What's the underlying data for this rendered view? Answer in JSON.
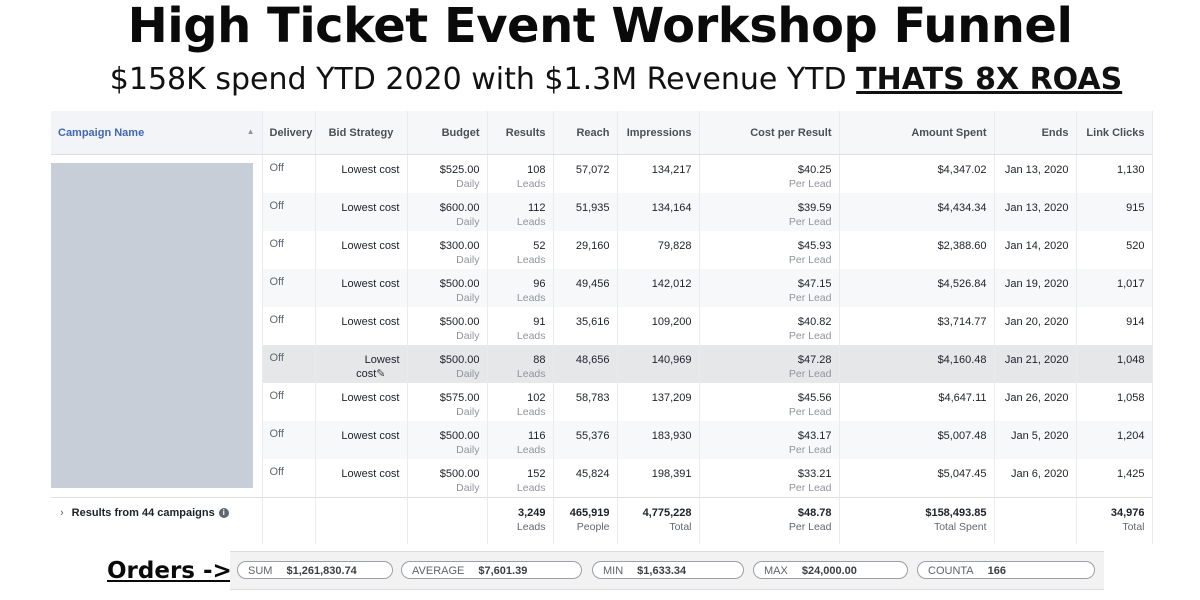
{
  "headline": "High Ticket Event Workshop Funnel",
  "subline": {
    "text": "$158K spend YTD 2020 with $1.3M Revenue YTD",
    "emphasis": "THATS 8X ROAS"
  },
  "table": {
    "headers": {
      "campaign_name": "Campaign Name",
      "delivery": "Delivery",
      "bid_strategy": "Bid Strategy",
      "budget": "Budget",
      "results": "Results",
      "reach": "Reach",
      "impressions": "Impressions",
      "cost_per_result": "Cost per Result",
      "amount_spent": "Amount Spent",
      "ends": "Ends",
      "link_clicks": "Link Clicks"
    },
    "sort_icon": "sort-up-icon",
    "rows": [
      {
        "delivery": "Off",
        "bid": "Lowest cost",
        "budget": "$525.00",
        "budget_sub": "Daily",
        "results": "108",
        "results_sub": "Leads",
        "reach": "57,072",
        "impressions": "134,217",
        "cpr": "$40.25",
        "cpr_sub": "Per Lead",
        "spent": "$4,347.02",
        "ends": "Jan 13, 2020",
        "clicks": "1,130"
      },
      {
        "delivery": "Off",
        "bid": "Lowest cost",
        "budget": "$600.00",
        "budget_sub": "Daily",
        "results": "112",
        "results_sub": "Leads",
        "reach": "51,935",
        "impressions": "134,164",
        "cpr": "$39.59",
        "cpr_sub": "Per Lead",
        "spent": "$4,434.34",
        "ends": "Jan 13, 2020",
        "clicks": "915"
      },
      {
        "delivery": "Off",
        "bid": "Lowest cost",
        "budget": "$300.00",
        "budget_sub": "Daily",
        "results": "52",
        "results_sub": "Leads",
        "reach": "29,160",
        "impressions": "79,828",
        "cpr": "$45.93",
        "cpr_sub": "Per Lead",
        "spent": "$2,388.60",
        "ends": "Jan 14, 2020",
        "clicks": "520"
      },
      {
        "delivery": "Off",
        "bid": "Lowest cost",
        "budget": "$500.00",
        "budget_sub": "Daily",
        "results": "96",
        "results_sub": "Leads",
        "reach": "49,456",
        "impressions": "142,012",
        "cpr": "$47.15",
        "cpr_sub": "Per Lead",
        "spent": "$4,526.84",
        "ends": "Jan 19, 2020",
        "clicks": "1,017"
      },
      {
        "delivery": "Off",
        "bid": "Lowest cost",
        "budget": "$500.00",
        "budget_sub": "Daily",
        "results": "91",
        "results_sub": "Leads",
        "reach": "35,616",
        "impressions": "109,200",
        "cpr": "$40.82",
        "cpr_sub": "Per Lead",
        "spent": "$3,714.77",
        "ends": "Jan 20, 2020",
        "clicks": "914"
      },
      {
        "delivery": "Off",
        "bid": "Lowest cost",
        "budget": "$500.00",
        "budget_sub": "Daily",
        "results": "88",
        "results_sub": "Leads",
        "reach": "48,656",
        "impressions": "140,969",
        "cpr": "$47.28",
        "cpr_sub": "Per Lead",
        "spent": "$4,160.48",
        "ends": "Jan 21, 2020",
        "clicks": "1,048",
        "highlighted": true
      },
      {
        "delivery": "Off",
        "bid": "Lowest cost",
        "budget": "$575.00",
        "budget_sub": "Daily",
        "results": "102",
        "results_sub": "Leads",
        "reach": "58,783",
        "impressions": "137,209",
        "cpr": "$45.56",
        "cpr_sub": "Per Lead",
        "spent": "$4,647.11",
        "ends": "Jan 26, 2020",
        "clicks": "1,058"
      },
      {
        "delivery": "Off",
        "bid": "Lowest cost",
        "budget": "$500.00",
        "budget_sub": "Daily",
        "results": "116",
        "results_sub": "Leads",
        "reach": "55,376",
        "impressions": "183,930",
        "cpr": "$43.17",
        "cpr_sub": "Per Lead",
        "spent": "$5,007.48",
        "ends": "Jan 5, 2020",
        "clicks": "1,204"
      },
      {
        "delivery": "Off",
        "bid": "Lowest cost",
        "budget": "$500.00",
        "budget_sub": "Daily",
        "results": "152",
        "results_sub": "Leads",
        "reach": "45,824",
        "impressions": "198,391",
        "cpr": "$33.21",
        "cpr_sub": "Per Lead",
        "spent": "$5,047.45",
        "ends": "Jan 6, 2020",
        "clicks": "1,425"
      }
    ],
    "summary": {
      "label": "Results from 44 campaigns",
      "results": "3,249",
      "results_sub": "Leads",
      "reach": "465,919",
      "reach_sub": "People",
      "impressions": "4,775,228",
      "impressions_sub": "Total",
      "cpr": "$48.78",
      "cpr_sub": "Per Lead",
      "spent": "$158,493.85",
      "spent_sub": "Total Spent",
      "clicks": "34,976",
      "clicks_sub": "Total"
    }
  },
  "orders": {
    "label": "Orders ->",
    "stats": [
      {
        "name": "SUM",
        "value": "$1,261,830.74"
      },
      {
        "name": "AVERAGE",
        "value": "$7,601.39"
      },
      {
        "name": "MIN",
        "value": "$1,633.34"
      },
      {
        "name": "MAX",
        "value": "$24,000.00"
      },
      {
        "name": "COUNTA",
        "value": "166"
      }
    ]
  }
}
